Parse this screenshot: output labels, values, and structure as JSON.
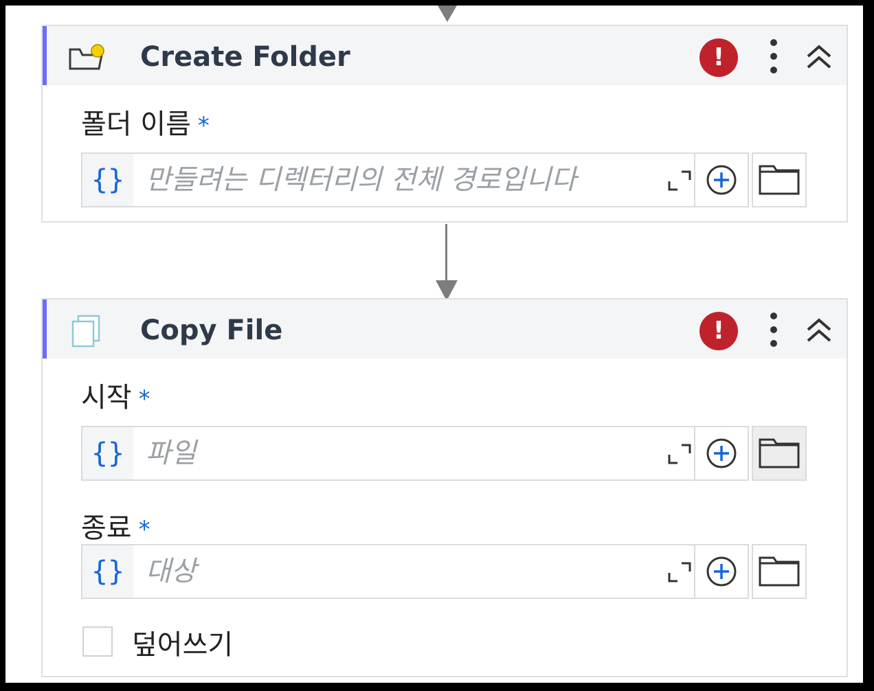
{
  "create_folder": {
    "title": "Create Folder",
    "error_icon": "!",
    "field": {
      "label": "폴더 이름",
      "required_marker": "*",
      "variable_icon": "{}",
      "placeholder": "만들려는 디렉터리의 전체 경로입니다"
    }
  },
  "copy_file": {
    "title": "Copy File",
    "error_icon": "!",
    "source": {
      "label": "시작",
      "required_marker": "*",
      "variable_icon": "{}",
      "placeholder": "파일"
    },
    "destination": {
      "label": "종료",
      "required_marker": "*",
      "variable_icon": "{}",
      "placeholder": "대상"
    },
    "overwrite": {
      "label": "덮어쓰기",
      "checked": false
    }
  },
  "icons": {
    "folder_new": "folder-new-icon",
    "copy_file": "copy-file-icon",
    "error": "error-icon",
    "more": "more-vertical-icon",
    "collapse": "chevron-double-up-icon",
    "expand": "expand-icon",
    "add": "plus-circle-icon",
    "browse": "folder-icon"
  },
  "colors": {
    "accent": "#6b6bff",
    "error": "#c0222b",
    "link_blue": "#1565d8",
    "header_bg": "#f4f5f6"
  }
}
